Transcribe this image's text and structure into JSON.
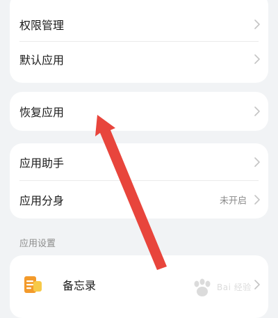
{
  "card1": {
    "items": [
      {
        "label": "权限管理"
      },
      {
        "label": "默认应用"
      }
    ]
  },
  "card2": {
    "items": [
      {
        "label": "恢复应用"
      }
    ]
  },
  "card3": {
    "items": [
      {
        "label": "应用助手",
        "value": ""
      },
      {
        "label": "应用分身",
        "value": "未开启"
      }
    ]
  },
  "section": {
    "title": "应用设置"
  },
  "card4": {
    "items": [
      {
        "label": "备忘录",
        "icon": "notes-app-icon"
      }
    ]
  },
  "watermark": {
    "text": "Bai 经验"
  },
  "colors": {
    "annotation_arrow": "#e8453c",
    "notes_icon_orange": "#f39a2b",
    "notes_icon_yellow": "#f7c948"
  }
}
